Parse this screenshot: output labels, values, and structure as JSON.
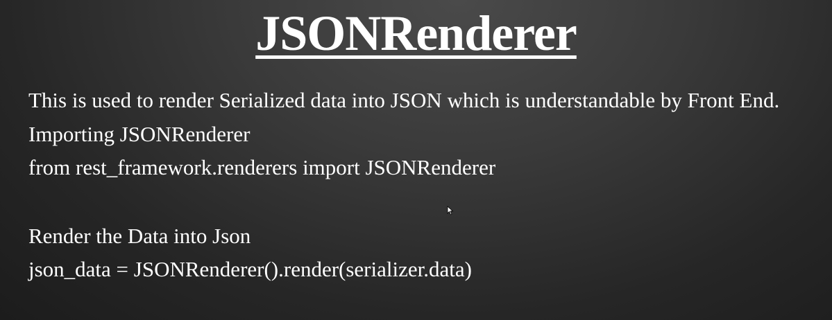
{
  "slide": {
    "title": "JSONRenderer",
    "lines": [
      "This is used to render Serialized data into JSON which is understandable by Front End.",
      "Importing JSONRenderer",
      "from rest_framework.renderers import JSONRenderer",
      "Render the Data into Json",
      "json_data = JSONRenderer().render(serializer.data)"
    ]
  },
  "icons": {
    "cursor": "mouse-pointer-icon"
  },
  "colors": {
    "text": "#ffffff",
    "background": "#2a2a2a"
  }
}
